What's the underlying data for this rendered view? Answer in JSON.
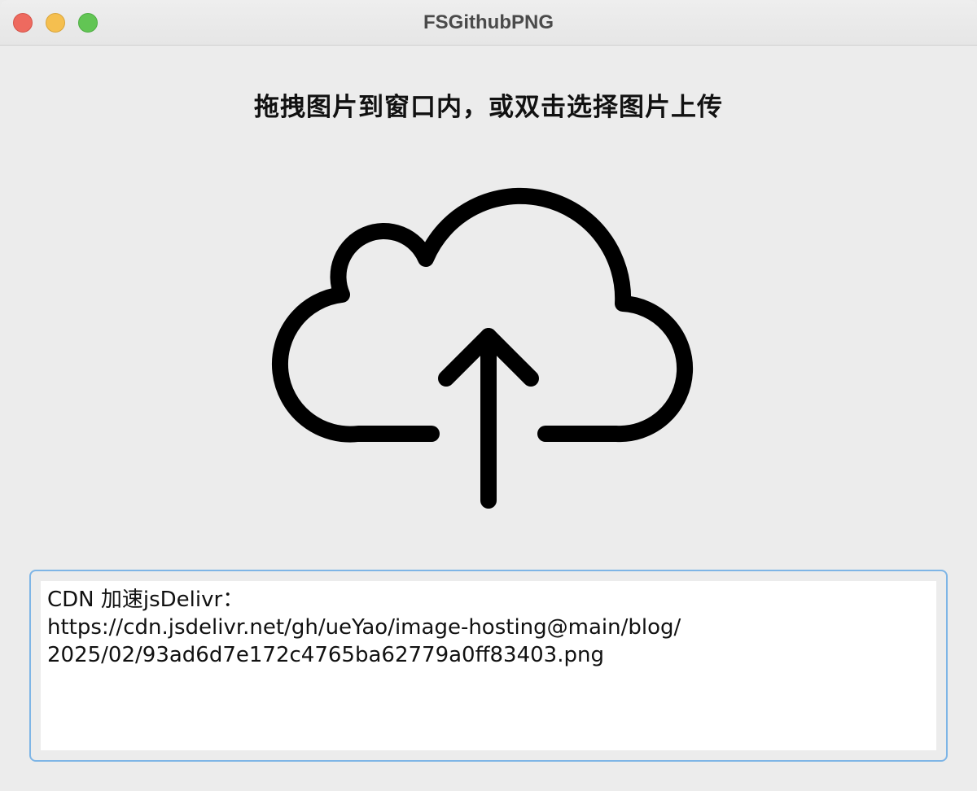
{
  "window": {
    "title": "FSGithubPNG",
    "controls": {
      "close_color": "#ee6a5f",
      "minimize_color": "#f5bf4f",
      "zoom_color": "#62c554"
    }
  },
  "main": {
    "instruction": "拖拽图片到窗口内，或双击选择图片上传",
    "upload_icon": "cloud-upload-icon"
  },
  "output": {
    "line1": "CDN 加速jsDelivr：",
    "line2": "https://cdn.jsdelivr.net/gh/ueYao/image-hosting@main/blog/",
    "line3": "2025/02/93ad6d7e172c4765ba62779a0ff83403.png",
    "border_color": "#7eb5e6"
  }
}
